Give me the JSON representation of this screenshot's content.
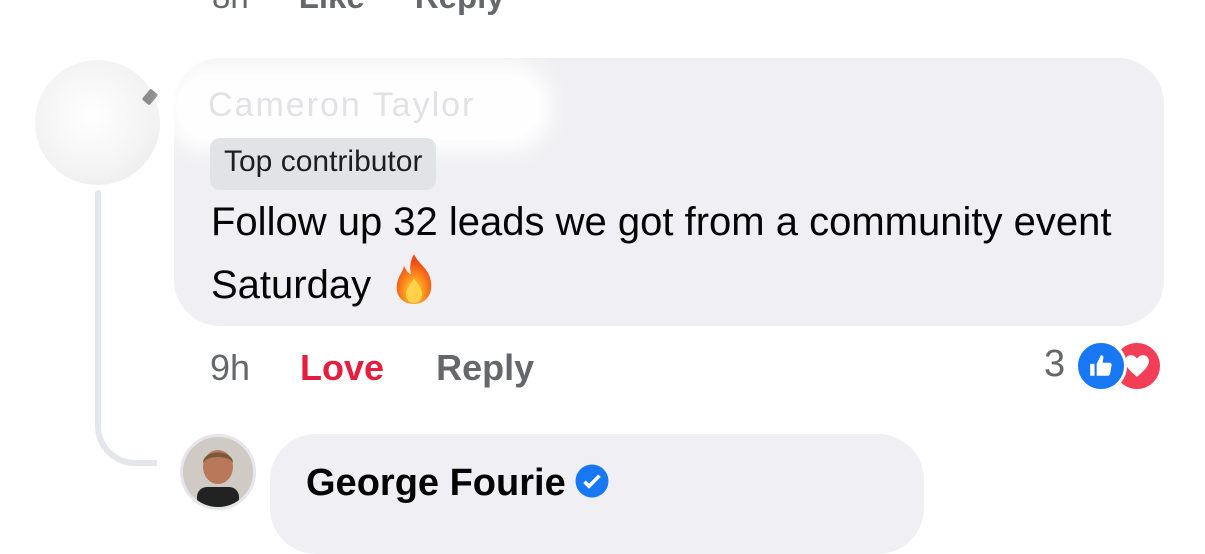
{
  "previous_comment": {
    "time": "8h",
    "like_label": "Like",
    "reply_label": "Reply"
  },
  "comment": {
    "author": "Cameron Taylor",
    "badge": "Top contributor",
    "text": "Follow up 32 leads we got from a community event Saturday",
    "emoji": "fire-icon",
    "time": "9h",
    "love_label": "Love",
    "reply_label": "Reply",
    "reaction_count": "3",
    "reactions": [
      "like-icon",
      "love-icon"
    ]
  },
  "next_reply": {
    "author": "George Fourie",
    "verified": "verified-badge-icon"
  },
  "colors": {
    "bubble": "#f0f0f4",
    "love": "#e41e3f",
    "like": "#1877f2",
    "muted": "#65676b"
  }
}
